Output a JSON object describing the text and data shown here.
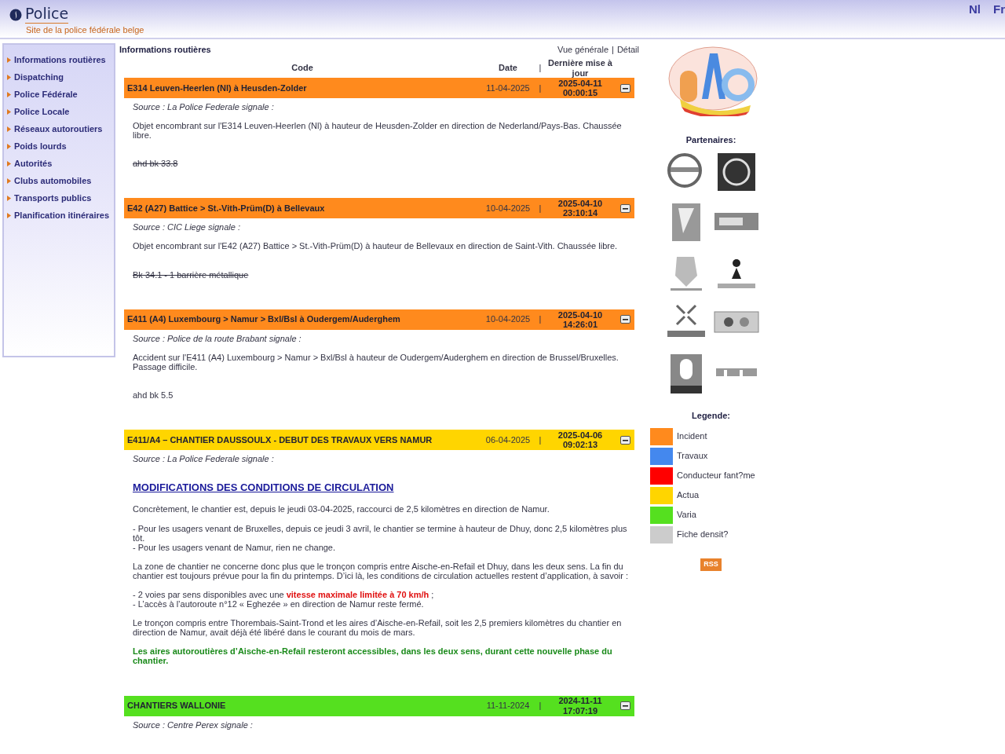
{
  "header": {
    "brand": "Police",
    "tagline": "Site de la police fédérale belge",
    "languages": [
      "Nl",
      "Fr"
    ]
  },
  "sidebar": {
    "items": [
      "Informations routières",
      "Dispatching",
      "Police Fédérale",
      "Police Locale",
      "Réseaux autoroutiers",
      "Poids lourds",
      "Autorités",
      "Clubs automobiles",
      "Transports publics",
      "Planification itinéraires"
    ]
  },
  "main": {
    "title": "Informations routières",
    "views": [
      "Vue générale",
      "Détail"
    ],
    "views_separator": "|",
    "columns": [
      "Code",
      "Date",
      "Dernière mise à jour"
    ],
    "columns_separator": "|"
  },
  "entries": [
    {
      "code": "E314 Leuven-Heerlen (Nl) à Heusden-Zolder",
      "date": "11-04-2025",
      "separator": "|",
      "updated_date": "2025-04-11",
      "updated_time": "00:00:15",
      "color": "#ff8a1d",
      "body": [
        {
          "kind": "source",
          "text": "Source : La Police Federale signale :"
        },
        {
          "kind": "text",
          "text": "Objet encombrant sur l'E314 Leuven-Heerlen (Nl) à hauteur de Heusden-Zolder en direction de Nederland/Pays-Bas. Chaussée libre."
        },
        {
          "kind": "struck",
          "text": "ahd bk 33.8"
        }
      ]
    },
    {
      "code": "E42 (A27) Battice > St.-Vith-Prüm(D) à Bellevaux",
      "date": "10-04-2025",
      "separator": "|",
      "updated_date": "2025-04-10",
      "updated_time": "23:10:14",
      "color": "#ff8a1d",
      "body": [
        {
          "kind": "source",
          "text": "Source : CIC Liege signale :"
        },
        {
          "kind": "text",
          "text": "Objet encombrant sur l'E42 (A27) Battice > St.-Vith-Prüm(D) à hauteur de Bellevaux en direction de Saint-Vith. Chaussée libre."
        },
        {
          "kind": "struck",
          "text": "Bk 34.1 - 1 barrière métallique"
        }
      ]
    },
    {
      "code": "E411 (A4) Luxembourg > Namur > Bxl/Bsl à Oudergem/Auderghem",
      "date": "10-04-2025",
      "separator": "|",
      "updated_date": "2025-04-10",
      "updated_time": "14:26:01",
      "color": "#ff8a1d",
      "body": [
        {
          "kind": "source",
          "text": "Source : Police de la route Brabant signale :"
        },
        {
          "kind": "text",
          "text": "Accident sur l'E411 (A4) Luxembourg > Namur > Bxl/Bsl à hauteur de Oudergem/Auderghem en direction de Brussel/Bruxelles. Passage difficile."
        },
        {
          "kind": "note",
          "text": "ahd bk 5.5"
        }
      ]
    },
    {
      "code": "E411/A4 – CHANTIER DAUSSOULX - DEBUT DES TRAVAUX VERS NAMUR",
      "date": "06-04-2025",
      "separator": "|",
      "updated_date": "2025-04-06",
      "updated_time": "09:02:13",
      "color": "#ffd500",
      "body": [
        {
          "kind": "source",
          "text": "Source : La Police Federale signale :"
        },
        {
          "kind": "heading",
          "text": "MODIFICATIONS DES CONDITIONS DE CIRCULATION"
        },
        {
          "kind": "text",
          "text": "Concrètement, le chantier est, depuis le jeudi 03-04-2025, raccourci de 2,5 kilomètres en direction de Namur."
        },
        {
          "kind": "lines",
          "lines": [
            "- Pour les usagers venant de Bruxelles, depuis ce jeudi 3 avril, le chantier se termine à hauteur de Dhuy, donc 2,5 kilomètres plus tôt.",
            "- Pour les usagers venant de Namur, rien ne change."
          ]
        },
        {
          "kind": "text",
          "text": "La zone de chantier ne concerne donc plus que le tronçon compris entre Aische-en-Refail et Dhuy, dans les deux sens. La fin du chantier est toujours prévue pour la fin du printemps. D’ici là, les conditions de circulation actuelles restent d’application, à savoir :"
        },
        {
          "kind": "warning-lines",
          "lines": [
            "- 2 voies par sens disponibles avec une **vitesse maximale limitée à 70 km/h** ;",
            "- L’accès à l’autoroute n°12 « Eghezée » en direction de Namur reste fermé."
          ]
        },
        {
          "kind": "text",
          "text": "Le tronçon compris entre Thorembais-Saint-Trond et les aires d’Aische-en-Refail, soit les 2,5 premiers kilomètres du chantier en direction de Namur, avait déjà été libéré dans le courant du mois de mars."
        },
        {
          "kind": "highlight",
          "text": "Les aires autoroutières d’Aische-en-Refail resteront accessibles, dans les deux sens, durant cette nouvelle phase du chantier."
        }
      ]
    },
    {
      "code": "CHANTIERS WALLONIE",
      "date": "11-11-2024",
      "separator": "|",
      "updated_date": "2024-11-11",
      "updated_time": "17:07:19",
      "color": "#55e01f",
      "body": [
        {
          "kind": "source",
          "text": "Source : Centre Perex signale :"
        }
      ]
    }
  ],
  "partners": {
    "title": "Partenaires:"
  },
  "legend": {
    "title": "Legende:",
    "items": [
      {
        "label": "Incident",
        "color": "#ff8a1d"
      },
      {
        "label": "Travaux",
        "color": "#4488ee"
      },
      {
        "label": "Conducteur fant?me",
        "color": "#ff0000"
      },
      {
        "label": "Actua",
        "color": "#ffd500"
      },
      {
        "label": "Varia",
        "color": "#55e01f"
      },
      {
        "label": "Fiche densit?",
        "color": "#cccccc"
      }
    ]
  },
  "rss": "RSS"
}
